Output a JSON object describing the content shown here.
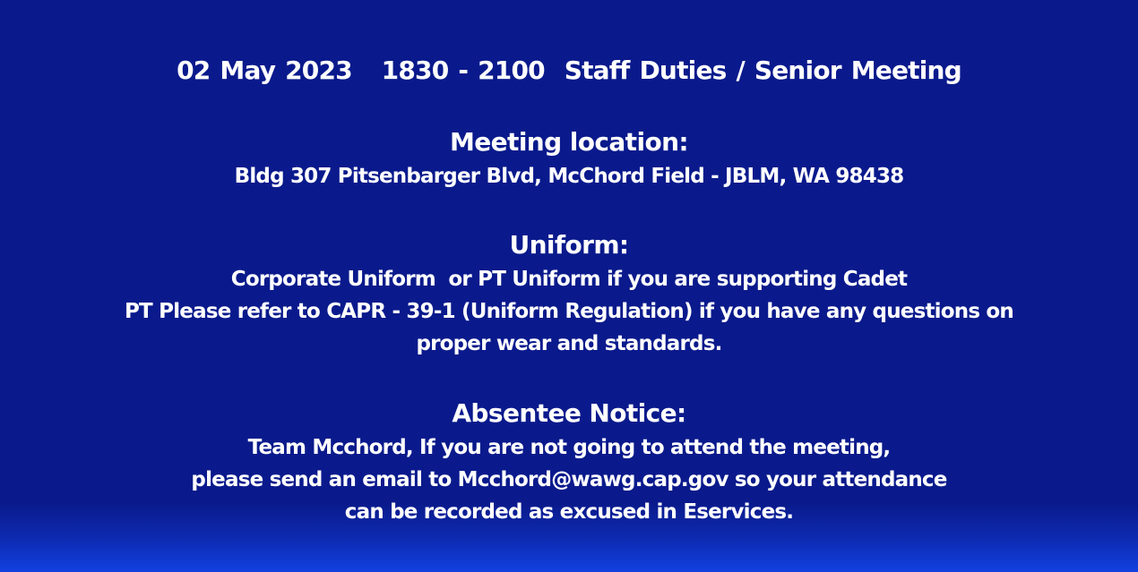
{
  "event": {
    "title": "02 May 2023   1830 - 2100  Staff Duties / Senior Meeting"
  },
  "location": {
    "heading": "Meeting location:",
    "address": "Bldg 307 Pitsenbarger Blvd, McChord Field - JBLM, WA 98438"
  },
  "uniform": {
    "heading": "Uniform:",
    "lines": [
      "Corporate Uniform  or PT Uniform if you are supporting Cadet",
      "PT Please refer to CAPR - 39-1 (Uniform Regulation) if you have any questions on",
      "proper wear and standards."
    ]
  },
  "absentee": {
    "heading": "Absentee Notice:",
    "lines": [
      "Team Mcchord, If you are not going to attend the meeting,",
      "please send an email to Mcchord@wawg.cap.gov so your attendance",
      "can be recorded as excused in Eservices."
    ]
  },
  "colors": {
    "background": "#0a1a8c",
    "text": "#ffffff"
  }
}
